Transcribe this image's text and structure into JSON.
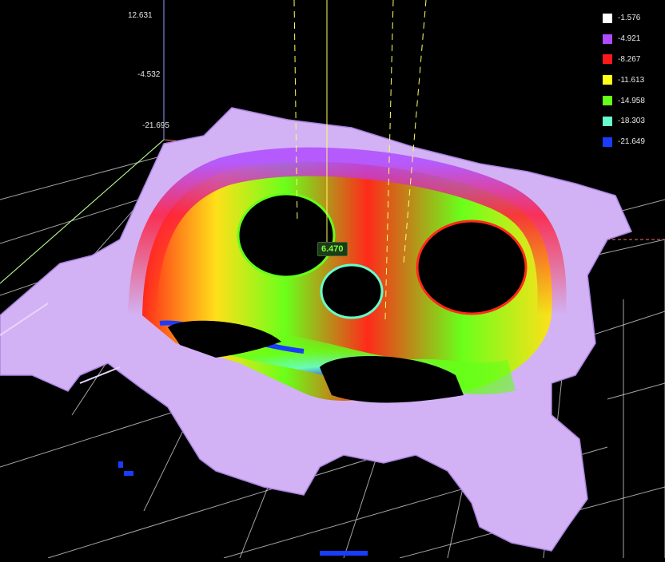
{
  "viewer": {
    "axis_labels": [
      "12.631",
      "-4.532",
      "-21.695"
    ],
    "probe_value": "6.470"
  },
  "legend": {
    "entries": [
      {
        "value": "-1.576",
        "color": "#ffffff"
      },
      {
        "value": "-4.921",
        "color": "#b04cff"
      },
      {
        "value": "-8.267",
        "color": "#ff1a1a"
      },
      {
        "value": "-11.613",
        "color": "#ffff1a"
      },
      {
        "value": "-14.958",
        "color": "#66ff1a"
      },
      {
        "value": "-18.303",
        "color": "#66ffcc"
      },
      {
        "value": "-21.649",
        "color": "#1a3cff"
      }
    ]
  }
}
